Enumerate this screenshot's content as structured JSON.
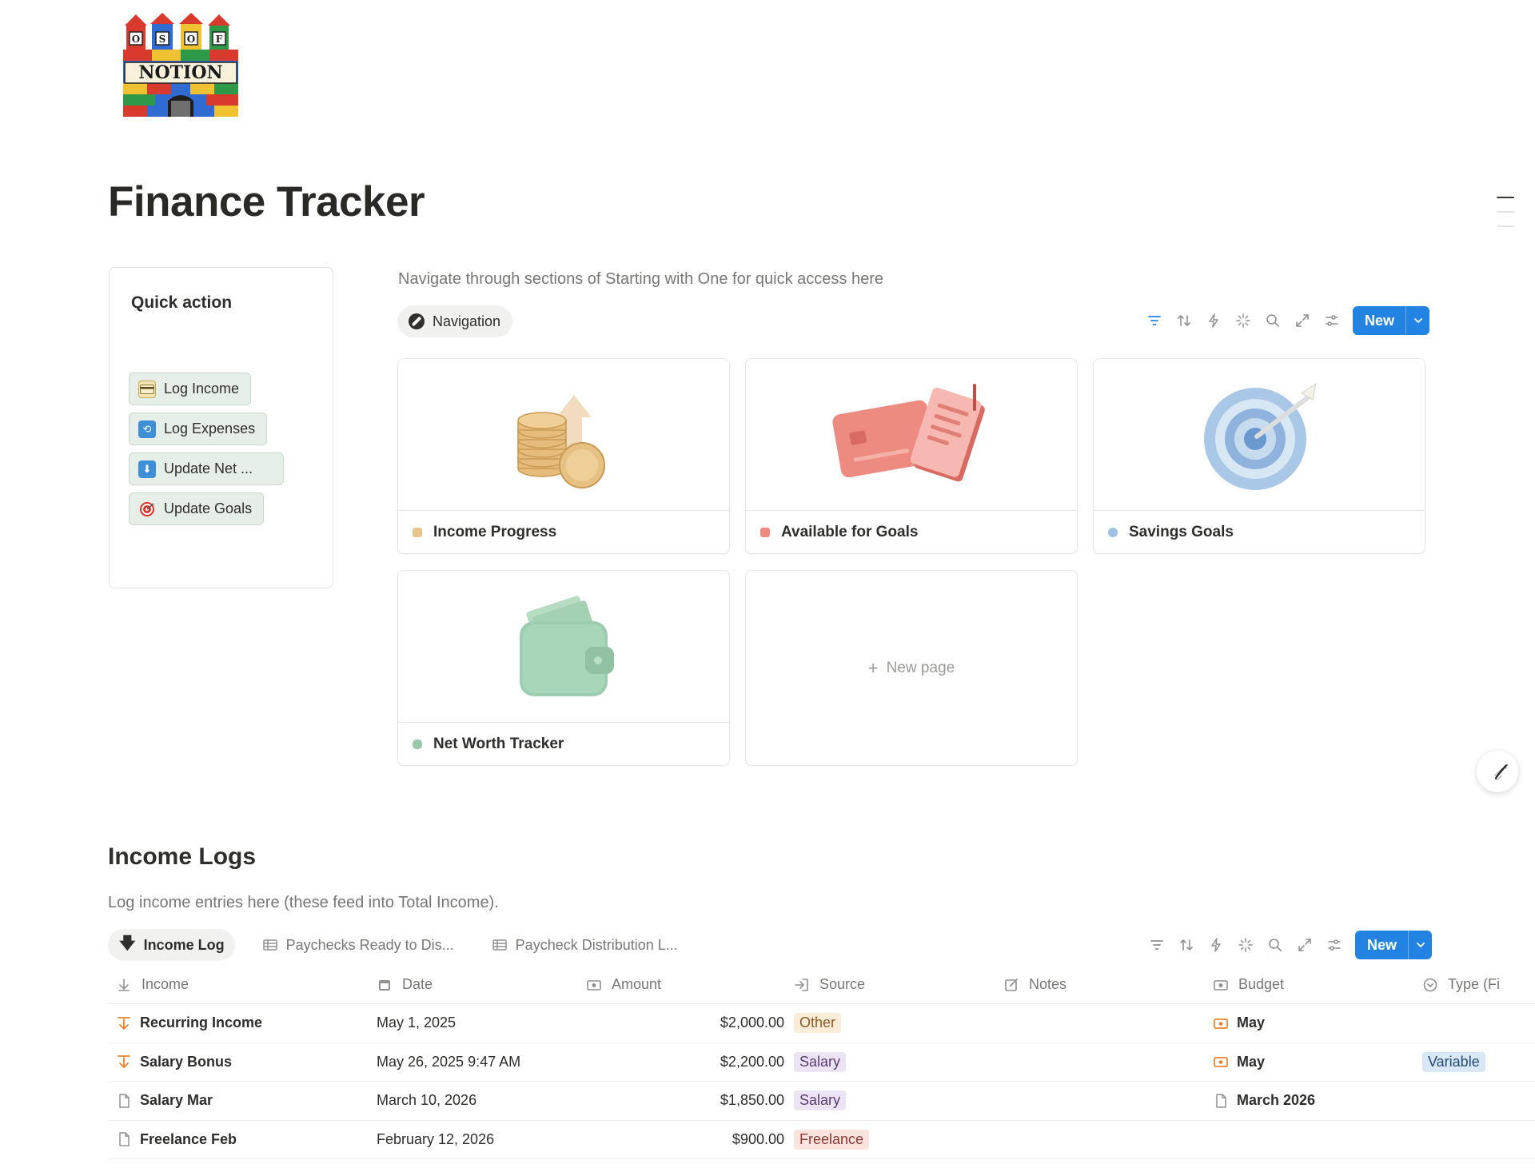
{
  "page": {
    "title": "Finance Tracker",
    "logo_text": [
      "O",
      "S",
      "O",
      "F",
      "NOTION"
    ]
  },
  "quick_action": {
    "title": "Quick action",
    "buttons": [
      {
        "label": "Log Income",
        "icon": "credit-card-icon"
      },
      {
        "label": "Log Expenses",
        "icon": "repeat-icon"
      },
      {
        "label": "Update Net ...",
        "icon": "down-arrow-icon"
      },
      {
        "label": "Update Goals",
        "icon": "target-icon"
      }
    ]
  },
  "navigation": {
    "description": "Navigate through sections of Starting with One for quick access here",
    "view_label": "Navigation",
    "new_label": "New",
    "cards": [
      {
        "label": "Income Progress",
        "icon": "coins-icon"
      },
      {
        "label": "Available for Goals",
        "icon": "card-icon"
      },
      {
        "label": "Savings Goals",
        "icon": "target-icon"
      },
      {
        "label": "Net Worth Tracker",
        "icon": "wallet-icon"
      }
    ],
    "new_page_label": "New page"
  },
  "income_logs": {
    "title": "Income Logs",
    "description": "Log income entries here (these feed into Total Income).",
    "new_label": "New",
    "tabs": [
      {
        "label": "Income Log",
        "active": true
      },
      {
        "label": "Paychecks Ready to Dis...",
        "active": false
      },
      {
        "label": "Paycheck Distribution L...",
        "active": false
      }
    ],
    "columns": {
      "income": "Income",
      "date": "Date",
      "amount": "Amount",
      "source": "Source",
      "notes": "Notes",
      "budget": "Budget",
      "type": "Type (Fi"
    },
    "rows": [
      {
        "income": "Recurring Income",
        "date": "May 1, 2025",
        "amount": "$2,000.00",
        "source": "Other",
        "source_color": "#fbecd8",
        "source_text": "#8a5a25",
        "budget": "May",
        "budget_icon": "budget-icon",
        "type": "",
        "row_icon": "arrow-down-icon"
      },
      {
        "income": "Salary Bonus",
        "date": "May 26, 2025 9:47 AM",
        "amount": "$2,200.00",
        "source": "Salary",
        "source_color": "#ece3f4",
        "source_text": "#5c3e75",
        "budget": "May",
        "budget_icon": "budget-icon",
        "type": "Variable",
        "row_icon": "arrow-down-icon"
      },
      {
        "income": "Salary Mar",
        "date": "March 10, 2026",
        "amount": "$1,850.00",
        "source": "Salary",
        "source_color": "#ece3f4",
        "source_text": "#5c3e75",
        "budget": "March 2026",
        "budget_icon": "page-icon",
        "type": "",
        "row_icon": "page-icon"
      },
      {
        "income": "Freelance Feb",
        "date": "February 12, 2026",
        "amount": "$900.00",
        "source": "Freelance",
        "source_color": "#fde3e0",
        "source_text": "#8d3a30",
        "budget": "",
        "budget_icon": "",
        "type": "",
        "row_icon": "page-icon"
      }
    ]
  },
  "colors": {
    "accent": "#2383e2",
    "text": "#37352f",
    "muted": "#787774",
    "orange_icon": "#e9822c"
  }
}
